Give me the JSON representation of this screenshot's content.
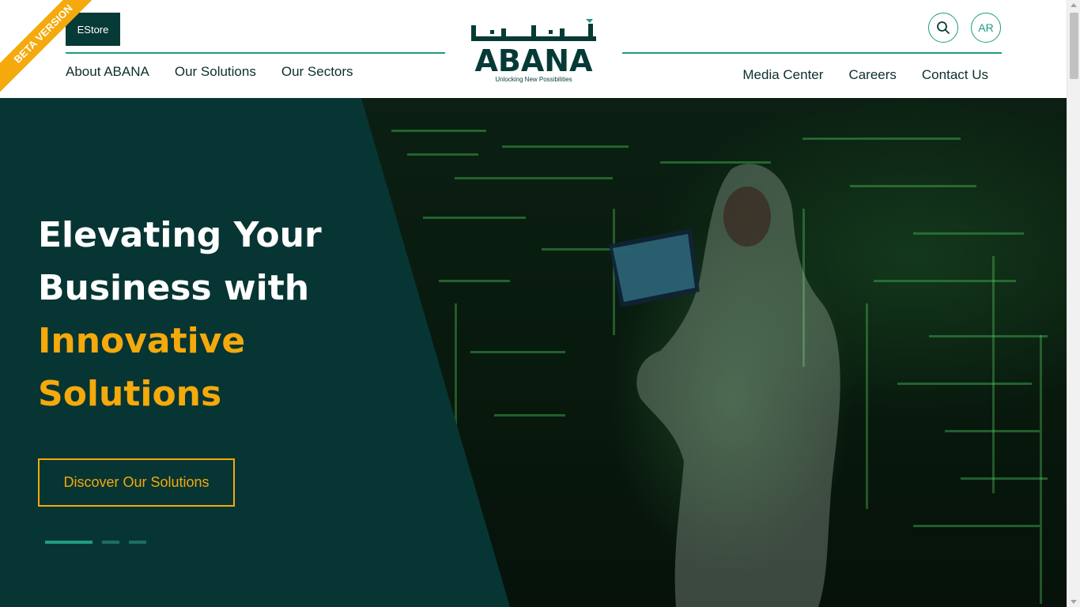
{
  "colors": {
    "brand_dark": "#063a37",
    "brand_green": "#1e9c82",
    "accent_gold": "#f4a90c",
    "hero_panel": "#073533"
  },
  "header": {
    "beta_label": "BETA VERSION",
    "estore_label": "EStore",
    "nav_left": [
      {
        "label": "About ABANA"
      },
      {
        "label": "Our Solutions"
      },
      {
        "label": "Our Sectors"
      }
    ],
    "nav_right": [
      {
        "label": "Media Center"
      },
      {
        "label": "Careers"
      },
      {
        "label": "Contact Us"
      }
    ],
    "logo": {
      "text": "ABANA",
      "tagline": "Unlocking New Possibilities"
    },
    "search_icon": "search-icon",
    "lang_label": "AR"
  },
  "hero": {
    "title_line1": "Elevating Your",
    "title_line2": "Business with",
    "title_line3": "Innovative",
    "title_line4": "Solutions",
    "cta_label": "Discover Our Solutions",
    "slides_total": 3,
    "slide_active": 1
  }
}
